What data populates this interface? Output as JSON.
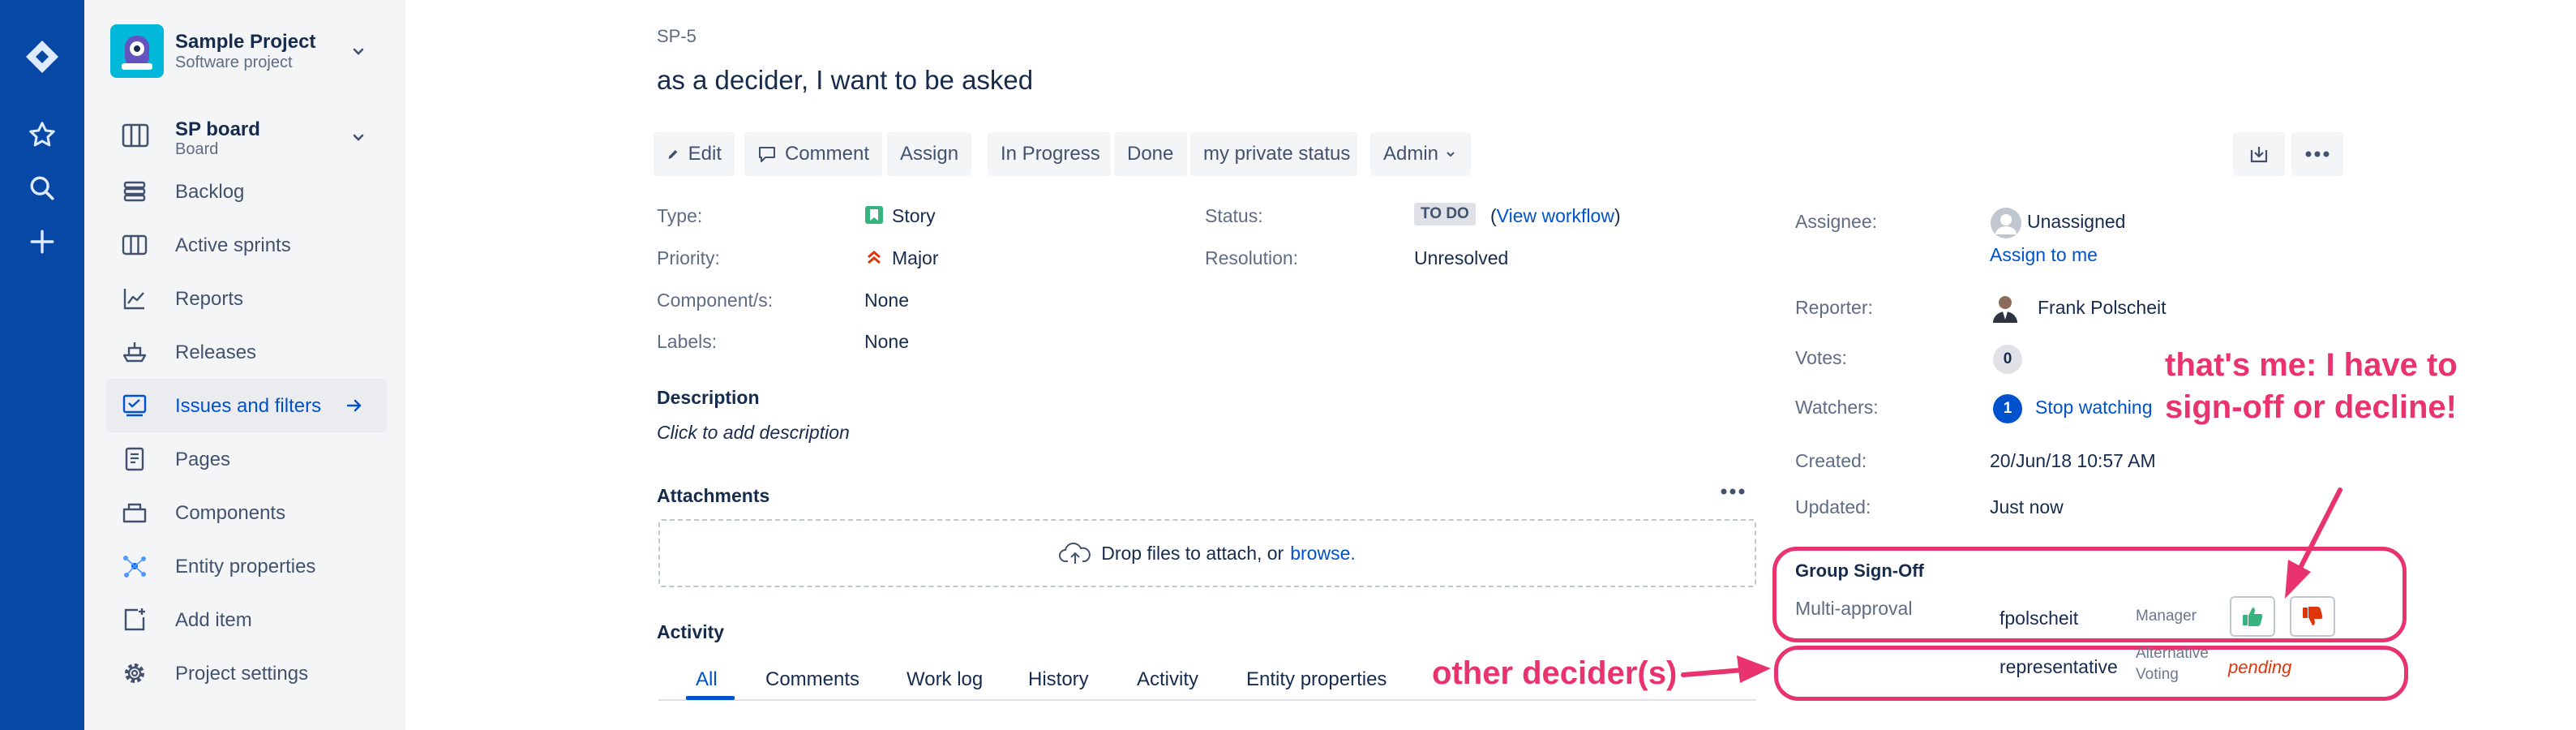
{
  "project": {
    "name": "Sample Project",
    "type": "Software project"
  },
  "sidebar": {
    "board": {
      "name": "SP board",
      "type": "Board"
    },
    "items": [
      {
        "label": "Backlog",
        "icon": "backlog-icon"
      },
      {
        "label": "Active sprints",
        "icon": "active-sprints-icon"
      },
      {
        "label": "Reports",
        "icon": "reports-icon"
      },
      {
        "label": "Releases",
        "icon": "releases-icon"
      },
      {
        "label": "Issues and filters",
        "icon": "issues-filters-icon",
        "active": true
      },
      {
        "label": "Pages",
        "icon": "pages-icon"
      },
      {
        "label": "Components",
        "icon": "components-icon"
      },
      {
        "label": "Entity properties",
        "icon": "entity-properties-icon"
      },
      {
        "label": "Add item",
        "icon": "add-item-icon"
      },
      {
        "label": "Project settings",
        "icon": "gear-icon"
      }
    ]
  },
  "issue": {
    "key": "SP-5",
    "title": "as a decider, I want to be asked"
  },
  "toolbar": {
    "edit": "Edit",
    "comment": "Comment",
    "assign": "Assign",
    "in_progress": "In Progress",
    "done": "Done",
    "private_status": "my private status",
    "admin": "Admin"
  },
  "details": {
    "type_label": "Type:",
    "type_value": "Story",
    "priority_label": "Priority:",
    "priority_value": "Major",
    "components_label": "Component/s:",
    "components_value": "None",
    "labels_label": "Labels:",
    "labels_value": "None",
    "status_label": "Status:",
    "status_value": "TO DO",
    "view_workflow": "View workflow",
    "resolution_label": "Resolution:",
    "resolution_value": "Unresolved"
  },
  "people": {
    "assignee_label": "Assignee:",
    "assignee_value": "Unassigned",
    "assign_to_me": "Assign to me",
    "reporter_label": "Reporter:",
    "reporter_value": "Frank Polscheit",
    "votes_label": "Votes:",
    "votes_count": "0",
    "watchers_label": "Watchers:",
    "watchers_count": "1",
    "stop_watching": "Stop watching"
  },
  "dates": {
    "created_label": "Created:",
    "created_value": "20/Jun/18 10:57 AM",
    "updated_label": "Updated:",
    "updated_value": "Just now"
  },
  "description": {
    "heading": "Description",
    "placeholder": "Click to add description"
  },
  "attachments": {
    "heading": "Attachments",
    "drop_text": "Drop files to attach, or",
    "browse": "browse."
  },
  "activity": {
    "heading": "Activity",
    "tabs": [
      "All",
      "Comments",
      "Work log",
      "History",
      "Activity",
      "Entity properties"
    ]
  },
  "signoff": {
    "heading": "Group Sign-Off",
    "mode": "Multi-approval",
    "rows": [
      {
        "user": "fpolscheit",
        "role": "Manager",
        "status": ""
      },
      {
        "user": "representative",
        "role_line1": "Alternative",
        "role_line2": "Voting",
        "status": "pending"
      }
    ]
  },
  "annotations": {
    "me_line1": "that's me: I have to",
    "me_line2": "sign-off or decline!",
    "other": "other decider(s)"
  },
  "colors": {
    "nav": "#0747a6",
    "link": "#0052cc",
    "annotation": "#e8336e",
    "pending": "#de350b"
  }
}
